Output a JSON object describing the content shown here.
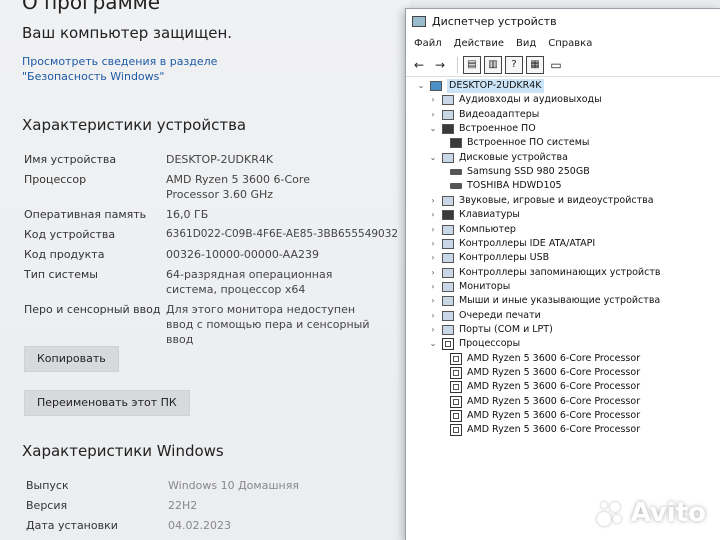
{
  "about": {
    "top_title": "О программе",
    "protected": "Ваш компьютер защищен.",
    "security_link": "Просмотреть сведения в разделе \"Безопасность Windows\"",
    "device_specs_title": "Характеристики устройства",
    "specs": [
      {
        "label": "Имя устройства",
        "value": "DESKTOP-2UDKR4K"
      },
      {
        "label": "Процессор",
        "value": "AMD Ryzen 5 3600 6-Core Processor 3.60 GHz"
      },
      {
        "label": "Оперативная память",
        "value": "16,0 ГБ"
      },
      {
        "label": "Код устройства",
        "value": "6361D022-C09B-4F6E-AE85-3BB655549032"
      },
      {
        "label": "Код продукта",
        "value": "00326-10000-00000-AA239"
      },
      {
        "label": "Тип системы",
        "value": "64-разрядная операционная система, процессор x64"
      },
      {
        "label": "Перо и сенсорный ввод",
        "value": "Для этого монитора недоступен ввод с помощью пера и сенсорный ввод"
      }
    ],
    "copy_button": "Копировать",
    "rename_button": "Переименовать этот ПК",
    "windows_specs_title": "Характеристики Windows",
    "windows_specs": [
      {
        "label": "Выпуск",
        "value": "Windows 10 Домашняя"
      },
      {
        "label": "Версия",
        "value": "22H2"
      },
      {
        "label": "Дата установки",
        "value": "04.02.2023"
      }
    ]
  },
  "device_manager": {
    "title": "Диспетчер устройств",
    "menu": [
      "Файл",
      "Действие",
      "Вид",
      "Справка"
    ],
    "toolbar_icons": [
      "back-arrow-icon",
      "forward-arrow-icon",
      "properties-icon",
      "view-icon",
      "help-icon",
      "scan-icon",
      "monitor-icon"
    ],
    "tree": [
      {
        "label": "DESKTOP-2UDKR4K",
        "level": 0,
        "expanded": true,
        "icon": "computer-icon"
      },
      {
        "label": "Аудиовходы и аудиовыходы",
        "level": 1,
        "expanded": false,
        "icon": "audio-icon"
      },
      {
        "label": "Видеоадаптеры",
        "level": 1,
        "expanded": false,
        "icon": "display-adapter-icon"
      },
      {
        "label": "Встроенное ПО",
        "level": 1,
        "expanded": true,
        "icon": "firmware-icon"
      },
      {
        "label": "Встроенное ПО системы",
        "level": 2,
        "expanded": null,
        "icon": "firmware-icon"
      },
      {
        "label": "Дисковые устройства",
        "level": 1,
        "expanded": true,
        "icon": "disk-icon"
      },
      {
        "label": "Samsung SSD 980 250GB",
        "level": 2,
        "expanded": null,
        "icon": "disk-icon"
      },
      {
        "label": "TOSHIBA HDWD105",
        "level": 2,
        "expanded": null,
        "icon": "disk-icon"
      },
      {
        "label": "Звуковые, игровые и видеоустройства",
        "level": 1,
        "expanded": false,
        "icon": "sound-icon"
      },
      {
        "label": "Клавиатуры",
        "level": 1,
        "expanded": false,
        "icon": "keyboard-icon"
      },
      {
        "label": "Компьютер",
        "level": 1,
        "expanded": false,
        "icon": "computer-icon"
      },
      {
        "label": "Контроллеры IDE ATA/ATAPI",
        "level": 1,
        "expanded": false,
        "icon": "ide-controller-icon"
      },
      {
        "label": "Контроллеры USB",
        "level": 1,
        "expanded": false,
        "icon": "usb-icon"
      },
      {
        "label": "Контроллеры запоминающих устройств",
        "level": 1,
        "expanded": false,
        "icon": "storage-controller-icon"
      },
      {
        "label": "Мониторы",
        "level": 1,
        "expanded": false,
        "icon": "monitor-icon"
      },
      {
        "label": "Мыши и иные указывающие устройства",
        "level": 1,
        "expanded": false,
        "icon": "mouse-icon"
      },
      {
        "label": "Очереди печати",
        "level": 1,
        "expanded": false,
        "icon": "printer-icon"
      },
      {
        "label": "Порты (COM и LPT)",
        "level": 1,
        "expanded": false,
        "icon": "port-icon"
      },
      {
        "label": "Процессоры",
        "level": 1,
        "expanded": true,
        "icon": "processor-icon"
      },
      {
        "label": "AMD Ryzen 5 3600 6-Core Processor",
        "level": 2,
        "expanded": null,
        "icon": "processor-icon"
      },
      {
        "label": "AMD Ryzen 5 3600 6-Core Processor",
        "level": 2,
        "expanded": null,
        "icon": "processor-icon"
      },
      {
        "label": "AMD Ryzen 5 3600 6-Core Processor",
        "level": 2,
        "expanded": null,
        "icon": "processor-icon"
      },
      {
        "label": "AMD Ryzen 5 3600 6-Core Processor",
        "level": 2,
        "expanded": null,
        "icon": "processor-icon"
      },
      {
        "label": "AMD Ryzen 5 3600 6-Core Processor",
        "level": 2,
        "expanded": null,
        "icon": "processor-icon"
      },
      {
        "label": "AMD Ryzen 5 3600 6-Core Processor",
        "level": 2,
        "expanded": null,
        "icon": "processor-icon"
      }
    ]
  },
  "watermark": {
    "brand": "Avito"
  },
  "colors": {
    "link": "#1e5aa5",
    "selection": "#cce4f7"
  }
}
